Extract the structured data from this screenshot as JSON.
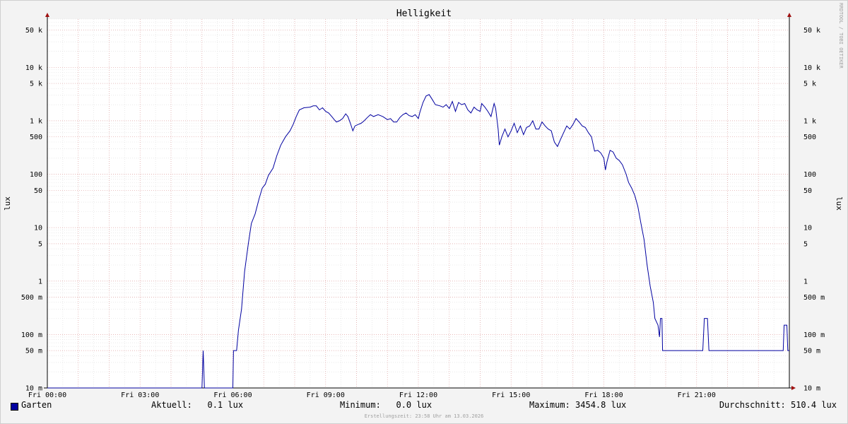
{
  "chart_data": {
    "type": "line",
    "title": "Helligkeit",
    "ylabel": "lux",
    "yscale": "log",
    "ylim": [
      0.01,
      80000
    ],
    "xlim_hours": [
      0,
      24
    ],
    "grid": true,
    "x_tick_labels": [
      {
        "hour": 0,
        "label": "Fri 00:00"
      },
      {
        "hour": 3,
        "label": "Fri 03:00"
      },
      {
        "hour": 6,
        "label": "Fri 06:00"
      },
      {
        "hour": 9,
        "label": "Fri 09:00"
      },
      {
        "hour": 12,
        "label": "Fri 12:00"
      },
      {
        "hour": 15,
        "label": "Fri 15:00"
      },
      {
        "hour": 18,
        "label": "Fri 18:00"
      },
      {
        "hour": 21,
        "label": "Fri 21:00"
      }
    ],
    "y_tick_labels": [
      {
        "value": 50000,
        "label": "50 k"
      },
      {
        "value": 10000,
        "label": "10 k"
      },
      {
        "value": 5000,
        "label": "5 k"
      },
      {
        "value": 1000,
        "label": "1 k"
      },
      {
        "value": 500,
        "label": "500"
      },
      {
        "value": 100,
        "label": "100"
      },
      {
        "value": 50,
        "label": "50"
      },
      {
        "value": 10,
        "label": "10"
      },
      {
        "value": 5,
        "label": "5"
      },
      {
        "value": 1,
        "label": "1"
      },
      {
        "value": 0.5,
        "label": "500 m"
      },
      {
        "value": 0.1,
        "label": "100 m"
      },
      {
        "value": 0.05,
        "label": "50 m"
      },
      {
        "value": 0.01,
        "label": "10 m"
      }
    ],
    "series": [
      {
        "name": "Garten",
        "color": "#0000a0",
        "points": [
          [
            0.0,
            0.01
          ],
          [
            5.0,
            0.01
          ],
          [
            5.04,
            0.05
          ],
          [
            5.08,
            0.01
          ],
          [
            6.0,
            0.01
          ],
          [
            6.02,
            0.05
          ],
          [
            6.12,
            0.05
          ],
          [
            6.18,
            0.12
          ],
          [
            6.28,
            0.3
          ],
          [
            6.38,
            1.5
          ],
          [
            6.5,
            5
          ],
          [
            6.6,
            12
          ],
          [
            6.72,
            18
          ],
          [
            6.85,
            35
          ],
          [
            6.95,
            55
          ],
          [
            7.05,
            65
          ],
          [
            7.15,
            95
          ],
          [
            7.3,
            130
          ],
          [
            7.42,
            220
          ],
          [
            7.55,
            350
          ],
          [
            7.7,
            500
          ],
          [
            7.85,
            650
          ],
          [
            7.95,
            850
          ],
          [
            8.05,
            1200
          ],
          [
            8.15,
            1600
          ],
          [
            8.3,
            1750
          ],
          [
            8.5,
            1800
          ],
          [
            8.6,
            1900
          ],
          [
            8.7,
            1900
          ],
          [
            8.8,
            1600
          ],
          [
            8.9,
            1750
          ],
          [
            9.0,
            1500
          ],
          [
            9.1,
            1400
          ],
          [
            9.2,
            1200
          ],
          [
            9.28,
            1050
          ],
          [
            9.35,
            950
          ],
          [
            9.45,
            1000
          ],
          [
            9.55,
            1100
          ],
          [
            9.65,
            1350
          ],
          [
            9.72,
            1200
          ],
          [
            9.8,
            900
          ],
          [
            9.88,
            650
          ],
          [
            9.95,
            800
          ],
          [
            10.05,
            850
          ],
          [
            10.15,
            900
          ],
          [
            10.25,
            1000
          ],
          [
            10.35,
            1150
          ],
          [
            10.45,
            1300
          ],
          [
            10.55,
            1200
          ],
          [
            10.7,
            1300
          ],
          [
            10.85,
            1200
          ],
          [
            11.0,
            1050
          ],
          [
            11.1,
            1100
          ],
          [
            11.2,
            950
          ],
          [
            11.3,
            950
          ],
          [
            11.4,
            1150
          ],
          [
            11.5,
            1300
          ],
          [
            11.6,
            1400
          ],
          [
            11.7,
            1250
          ],
          [
            11.8,
            1200
          ],
          [
            11.9,
            1300
          ],
          [
            12.0,
            1100
          ],
          [
            12.05,
            1450
          ],
          [
            12.15,
            2200
          ],
          [
            12.25,
            2900
          ],
          [
            12.35,
            3100
          ],
          [
            12.45,
            2500
          ],
          [
            12.55,
            2000
          ],
          [
            12.7,
            1900
          ],
          [
            12.8,
            1800
          ],
          [
            12.9,
            2000
          ],
          [
            13.0,
            1700
          ],
          [
            13.1,
            2300
          ],
          [
            13.2,
            1500
          ],
          [
            13.3,
            2200
          ],
          [
            13.4,
            2000
          ],
          [
            13.5,
            2100
          ],
          [
            13.6,
            1600
          ],
          [
            13.7,
            1400
          ],
          [
            13.8,
            1800
          ],
          [
            13.9,
            1600
          ],
          [
            14.0,
            1500
          ],
          [
            14.05,
            2100
          ],
          [
            14.15,
            1800
          ],
          [
            14.25,
            1500
          ],
          [
            14.35,
            1200
          ],
          [
            14.45,
            2100
          ],
          [
            14.5,
            1700
          ],
          [
            14.58,
            700
          ],
          [
            14.62,
            350
          ],
          [
            14.7,
            500
          ],
          [
            14.8,
            700
          ],
          [
            14.9,
            500
          ],
          [
            15.0,
            650
          ],
          [
            15.1,
            900
          ],
          [
            15.2,
            600
          ],
          [
            15.3,
            800
          ],
          [
            15.4,
            550
          ],
          [
            15.5,
            750
          ],
          [
            15.6,
            800
          ],
          [
            15.7,
            1000
          ],
          [
            15.8,
            700
          ],
          [
            15.9,
            700
          ],
          [
            16.0,
            950
          ],
          [
            16.1,
            800
          ],
          [
            16.2,
            700
          ],
          [
            16.3,
            650
          ],
          [
            16.4,
            400
          ],
          [
            16.5,
            330
          ],
          [
            16.6,
            450
          ],
          [
            16.7,
            600
          ],
          [
            16.8,
            800
          ],
          [
            16.9,
            700
          ],
          [
            17.0,
            850
          ],
          [
            17.1,
            1100
          ],
          [
            17.2,
            950
          ],
          [
            17.3,
            800
          ],
          [
            17.4,
            750
          ],
          [
            17.5,
            600
          ],
          [
            17.6,
            500
          ],
          [
            17.7,
            270
          ],
          [
            17.8,
            280
          ],
          [
            17.9,
            250
          ],
          [
            18.0,
            200
          ],
          [
            18.05,
            120
          ],
          [
            18.1,
            170
          ],
          [
            18.2,
            280
          ],
          [
            18.3,
            260
          ],
          [
            18.4,
            200
          ],
          [
            18.5,
            180
          ],
          [
            18.6,
            150
          ],
          [
            18.72,
            100
          ],
          [
            18.8,
            70
          ],
          [
            18.9,
            55
          ],
          [
            19.0,
            40
          ],
          [
            19.1,
            25
          ],
          [
            19.2,
            12
          ],
          [
            19.3,
            6
          ],
          [
            19.4,
            2
          ],
          [
            19.5,
            0.8
          ],
          [
            19.6,
            0.4
          ],
          [
            19.65,
            0.2
          ],
          [
            19.75,
            0.15
          ],
          [
            19.8,
            0.09
          ],
          [
            19.83,
            0.2
          ],
          [
            19.88,
            0.2
          ],
          [
            19.9,
            0.05
          ],
          [
            20.0,
            0.05
          ],
          [
            21.2,
            0.05
          ],
          [
            21.25,
            0.2
          ],
          [
            21.35,
            0.2
          ],
          [
            21.4,
            0.05
          ],
          [
            23.8,
            0.05
          ],
          [
            23.83,
            0.15
          ],
          [
            23.92,
            0.15
          ],
          [
            23.95,
            0.05
          ],
          [
            24.0,
            0.05
          ]
        ]
      }
    ]
  },
  "legend": {
    "series_name": "Garten",
    "current": "Aktuell:   0.1 lux",
    "minimum": "Minimum:   0.0 lux",
    "maximum": "Maximum: 3454.8 lux",
    "average": "Durchschnitt: 510.4 lux"
  },
  "watermark": "RRDTOOL / TOBI OETIKER",
  "timestamp": "Erstellungszeit: 23:58 Uhr am 13.03.2026"
}
